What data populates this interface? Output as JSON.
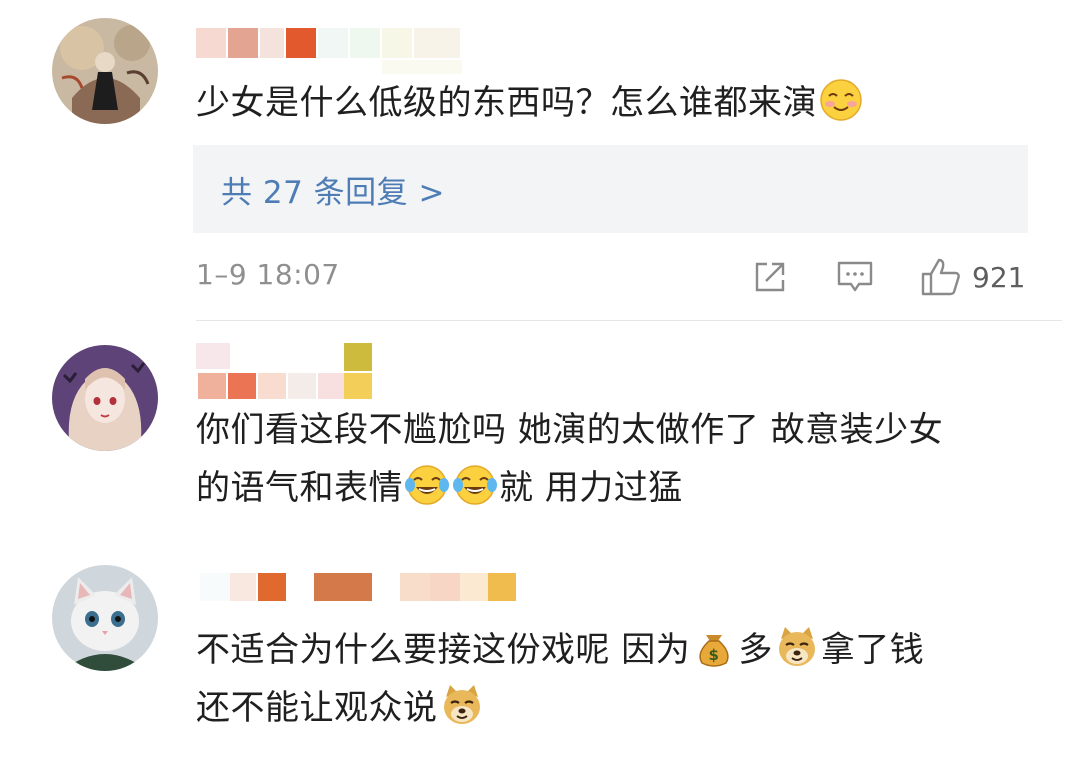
{
  "comments": [
    {
      "avatar": "girl-illustration-avatar",
      "text": "少女是什么低级的东西吗？怎么谁都来演",
      "emoji_after": "smiling-face-emoji",
      "replies_label": "共 27 条回复 >",
      "time": "1–9 18:07",
      "like_count": "921"
    },
    {
      "avatar": "anime-girl-avatar",
      "line1": "你们看这段不尴尬吗 她演的太做作了 故意装少女",
      "line2_a": "的语气和表情",
      "emoji_1": "tears-of-joy-emoji",
      "emoji_2": "tears-of-joy-emoji",
      "line2_b": "就 用力过猛"
    },
    {
      "avatar": "cat-avatar",
      "line1_a": "不适合为什么要接这份戏呢 因为",
      "emoji_money": "money-bag-emoji",
      "line1_b": "多",
      "emoji_doge": "doge-emoji",
      "line1_c": "拿了钱",
      "line2_a": "还不能让观众说",
      "emoji_doge2": "doge-emoji"
    }
  ],
  "colors": {
    "link": "#4e7db6",
    "reply_bg": "#f3f4f6",
    "meta": "#8f8f8f"
  }
}
